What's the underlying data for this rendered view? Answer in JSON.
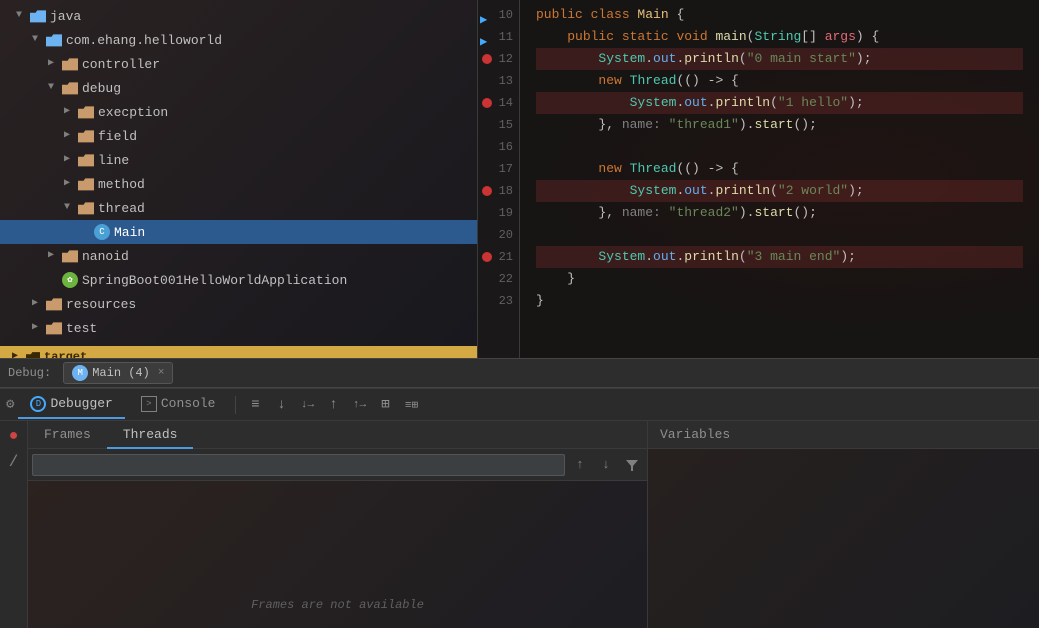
{
  "fileTree": {
    "items": [
      {
        "label": "java",
        "level": 1,
        "type": "folder",
        "open": true,
        "color": "blue"
      },
      {
        "label": "com.ehang.helloworld",
        "level": 2,
        "type": "folder",
        "open": true,
        "color": "blue"
      },
      {
        "label": "controller",
        "level": 3,
        "type": "folder",
        "open": false,
        "color": "brown"
      },
      {
        "label": "debug",
        "level": 3,
        "type": "folder",
        "open": true,
        "color": "brown"
      },
      {
        "label": "execption",
        "level": 4,
        "type": "folder",
        "open": false,
        "color": "brown"
      },
      {
        "label": "field",
        "level": 4,
        "type": "folder",
        "open": false,
        "color": "brown"
      },
      {
        "label": "line",
        "level": 4,
        "type": "folder",
        "open": false,
        "color": "brown"
      },
      {
        "label": "method",
        "level": 4,
        "type": "folder",
        "open": false,
        "color": "brown"
      },
      {
        "label": "thread",
        "level": 4,
        "type": "folder",
        "open": true,
        "color": "brown"
      },
      {
        "label": "Main",
        "level": 5,
        "type": "java-debug",
        "selected": true
      },
      {
        "label": "nanoid",
        "level": 3,
        "type": "folder",
        "open": false,
        "color": "brown"
      },
      {
        "label": "SpringBoot001HelloWorldApplication",
        "level": 3,
        "type": "spring"
      }
    ],
    "resources": {
      "label": "resources",
      "type": "folder",
      "open": false
    },
    "test": {
      "label": "test",
      "type": "folder",
      "open": false
    },
    "target": {
      "label": "target"
    }
  },
  "codeEditor": {
    "lines": [
      {
        "num": 10,
        "content": "public class Main {",
        "hasArrow": true
      },
      {
        "num": 11,
        "content": "    public static void main(String[] args) {",
        "hasArrow": true
      },
      {
        "num": 12,
        "content": "        System.out.println(\"0 main start\");",
        "hasBreakpoint": true,
        "highlighted": true
      },
      {
        "num": 13,
        "content": "        new Thread(() -> {"
      },
      {
        "num": 14,
        "content": "            System.out.println(\"1 hello\");",
        "hasBreakpoint": true,
        "highlighted": true
      },
      {
        "num": 15,
        "content": "        }, name: \"thread1\").start();"
      },
      {
        "num": 16,
        "content": ""
      },
      {
        "num": 17,
        "content": "        new Thread(() -> {"
      },
      {
        "num": 18,
        "content": "            System.out.println(\"2 world\");",
        "hasBreakpoint": true,
        "highlighted": true
      },
      {
        "num": 19,
        "content": "        }, name: \"thread2\").start();"
      },
      {
        "num": 20,
        "content": ""
      },
      {
        "num": 21,
        "content": "        System.out.println(\"3 main end\");",
        "hasBreakpoint": true,
        "highlighted": true
      },
      {
        "num": 22,
        "content": "    }"
      },
      {
        "num": 23,
        "content": "}"
      }
    ]
  },
  "debugBar": {
    "label": "Debug:",
    "sessionTab": "Main (4)",
    "closeLabel": "×"
  },
  "toolbar": {
    "debuggerLabel": "Debugger",
    "consoleLabel": "Console",
    "buttons": [
      "≡",
      "↓",
      "↓→",
      "↑",
      "↑→",
      "≡≡",
      "⊞",
      "≡⊞"
    ]
  },
  "bottomPanel": {
    "tabs": [
      {
        "label": "Frames",
        "active": false
      },
      {
        "label": "Threads",
        "active": true
      }
    ],
    "variablesHeader": "Variables",
    "framesPlaceholder": "",
    "notAvailable": "Frames are not available",
    "filterDropdownPlaceholder": "",
    "icons": {
      "up": "↑",
      "down": "↓",
      "filter": "⊿"
    }
  },
  "leftStrip": {
    "breakpointBtn": "●",
    "diagonalBtn": "/"
  }
}
